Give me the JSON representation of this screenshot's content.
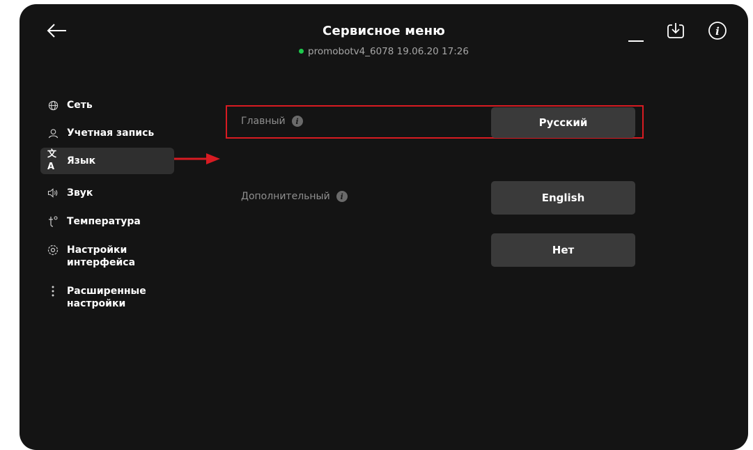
{
  "header": {
    "title": "Сервисное меню",
    "device_status": "promobotv4_6078 19.06.20 17:26",
    "status_color": "#1ec94c"
  },
  "icons": {
    "back": "arrow-left-icon",
    "minimize": "minimize-icon",
    "download": "download-icon",
    "info": "info-icon"
  },
  "sidebar": {
    "items": [
      {
        "label": "Сеть",
        "icon": "globe-icon",
        "active": false
      },
      {
        "label": "Учетная запись",
        "icon": "user-icon",
        "active": false
      },
      {
        "label": "Язык",
        "icon": "translate-icon",
        "active": true
      },
      {
        "label": "Звук",
        "icon": "speaker-icon",
        "active": false
      },
      {
        "label": "Температура",
        "icon": "temperature-icon",
        "active": false
      },
      {
        "label": "Настройки интерфейса",
        "icon": "gear-icon",
        "active": false
      },
      {
        "label": "Расширенные настройки",
        "icon": "more-vertical-icon",
        "active": false
      }
    ]
  },
  "language": {
    "primary_label": "Главный",
    "primary_value": "Русский",
    "secondary_label": "Дополнительный",
    "secondary_value": "English",
    "secondary_option_none": "Нет"
  },
  "colors": {
    "background": "#141414",
    "button": "#3a3a3a",
    "active_item": "#2f2f2f",
    "annotation": "#d81b22"
  }
}
